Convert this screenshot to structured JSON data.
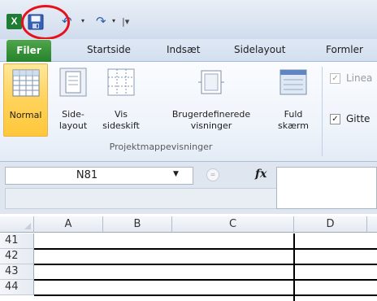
{
  "qat": {
    "app_icon_letter": "X",
    "undo_glyph": "↶",
    "redo_glyph": "↷",
    "dropdown_glyph": "▾",
    "customize_glyph": "|▾"
  },
  "tabs": {
    "file": "Filer",
    "items": [
      "Startside",
      "Indsæt",
      "Sidelayout",
      "Formler"
    ]
  },
  "ribbon": {
    "view_buttons": [
      {
        "line1": "Normal",
        "line2": ""
      },
      {
        "line1": "Side-",
        "line2": "layout"
      },
      {
        "line1": "Vis",
        "line2": "sideskift"
      },
      {
        "line1": "Brugerdefinerede",
        "line2": "visninger"
      },
      {
        "line1": "Fuld",
        "line2": "skærm"
      }
    ],
    "group_label": "Projektmappevisninger",
    "checkboxes": [
      {
        "label": "Linea",
        "checked_glyph": "✓"
      },
      {
        "label": "Gitte",
        "checked_glyph": "✓"
      }
    ]
  },
  "formula_bar": {
    "name_box": "N81",
    "dropdown_glyph": "▼",
    "fx_label": "fx",
    "cancel_glyph": "="
  },
  "grid": {
    "columns": [
      "A",
      "B",
      "C",
      "D"
    ],
    "rows": [
      "41",
      "42",
      "43",
      "44"
    ]
  },
  "colors": {
    "file_tab": "#26822c",
    "highlight_circle": "#e8101c",
    "selected_view": "#ffd25a"
  }
}
